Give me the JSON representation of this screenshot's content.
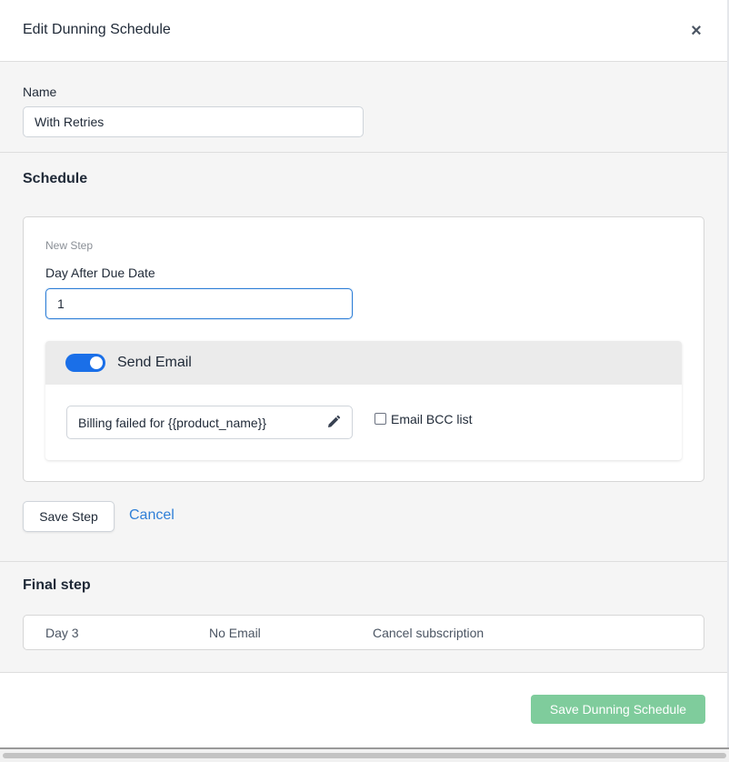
{
  "modal": {
    "title": "Edit Dunning Schedule",
    "close_symbol": "×"
  },
  "name_section": {
    "label": "Name",
    "value": "With Retries"
  },
  "schedule": {
    "title": "Schedule",
    "new_step": {
      "caption": "New Step",
      "day_label": "Day After Due Date",
      "day_value": "1",
      "send_email": {
        "label": "Send Email",
        "enabled": true,
        "subject": "Billing failed for {{product_name}}",
        "edit_icon": "pencil-icon",
        "bcc_label": "Email BCC list",
        "bcc_checked": false
      }
    },
    "save_step_label": "Save Step",
    "cancel_label": "Cancel"
  },
  "final_step": {
    "title": "Final step",
    "row": {
      "day": "Day 3",
      "email": "No Email",
      "action": "Cancel subscription"
    }
  },
  "footer": {
    "save_label": "Save Dunning Schedule"
  },
  "colors": {
    "accent": "#1a6fe8",
    "link": "#2f7fd7",
    "save_button": "#7fcc9c"
  }
}
